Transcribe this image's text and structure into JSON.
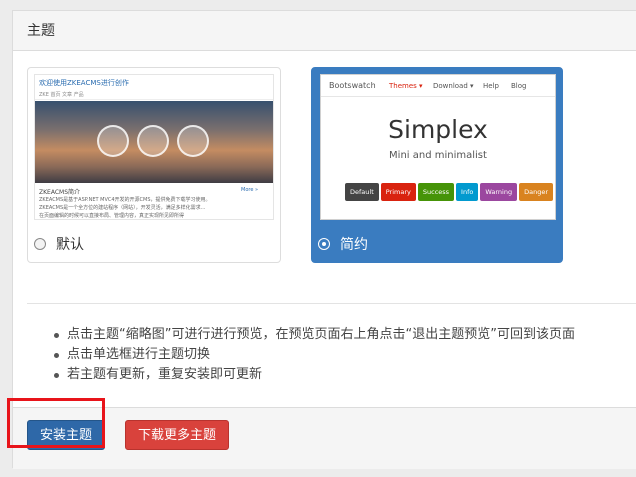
{
  "panel": {
    "title": "主题"
  },
  "themes": [
    {
      "name": "默认",
      "selected": false,
      "preview": {
        "site_title": "欢迎使用ZKEACMS进行创作",
        "nav": "ZKE    首页    文章    产品",
        "section_title": "ZKEACMS简介",
        "more": "More »",
        "lines": [
          "ZKEACMS是基于ASP.NET MVC4开发的开源CMS，提供免费下载学习使用。",
          "ZKEACMS是一个全方位的建站程序（网站），开发灵活，满足多样化需求...",
          "在页面编辑的时候可以直接布局、管理内容，真正实现所见即所得"
        ]
      }
    },
    {
      "name": "简约",
      "selected": true,
      "preview": {
        "brand": "Bootswatch",
        "nav": [
          "Themes ▾",
          "Download ▾",
          "Help",
          "Blog"
        ],
        "title": "Simplex",
        "subtitle": "Mini and minimalist",
        "buttons": [
          {
            "label": "Default",
            "color": "#444444"
          },
          {
            "label": "Primary",
            "color": "#d9230f"
          },
          {
            "label": "Success",
            "color": "#469408"
          },
          {
            "label": "Info",
            "color": "#029acf"
          },
          {
            "label": "Warning",
            "color": "#9b479f"
          },
          {
            "label": "Danger",
            "color": "#d9831f"
          }
        ]
      }
    }
  ],
  "tips": [
    "点击主题“缩略图”可进行进行预览，在预览页面右上角点击“退出主题预览”可回到该页面",
    "点击单选框进行主题切换",
    "若主题有更新，重复安装即可更新"
  ],
  "actions": {
    "install_label": "安装主题",
    "download_label": "下载更多主题"
  }
}
